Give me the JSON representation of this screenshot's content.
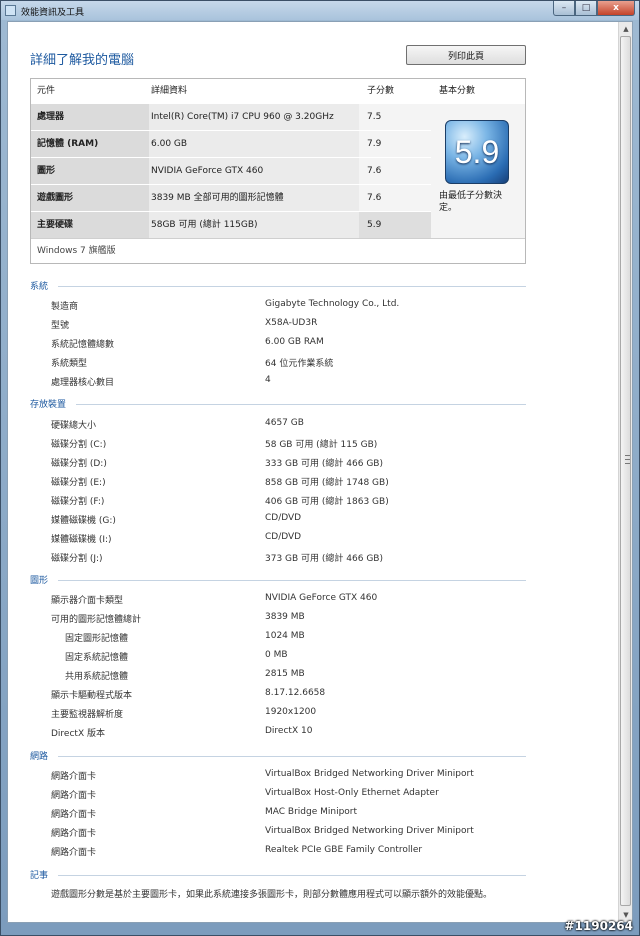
{
  "window": {
    "title": "效能資訊及工具",
    "min_glyph": "–",
    "max_glyph": "□",
    "close_glyph": "x"
  },
  "header": {
    "title": "詳細了解我的電腦",
    "print_label": "列印此頁"
  },
  "summary": {
    "columns": {
      "component": "元件",
      "details": "詳細資料",
      "subscore": "子分數",
      "base": "基本分數"
    },
    "rows": [
      {
        "component": "處理器",
        "details": "Intel(R) Core(TM) i7 CPU 960 @ 3.20GHz",
        "score": "7.5"
      },
      {
        "component": "記憶體 (RAM)",
        "details": "6.00 GB",
        "score": "7.9"
      },
      {
        "component": "圖形",
        "details": "NVIDIA GeForce GTX 460",
        "score": "7.6"
      },
      {
        "component": "遊戲圖形",
        "details": "3839 MB 全部可用的圖形記憶體",
        "score": "7.6"
      },
      {
        "component": "主要硬碟",
        "details": "58GB 可用 (總計 115GB)",
        "score": "5.9"
      }
    ],
    "base_score": "5.9",
    "base_note": "由最低子分數決定。",
    "edition": "Windows 7 旗艦版"
  },
  "sections": [
    {
      "title": "系統",
      "items": [
        {
          "label": "製造商",
          "value": "Gigabyte Technology Co., Ltd."
        },
        {
          "label": "型號",
          "value": "X58A-UD3R"
        },
        {
          "label": "系統記憶體總數",
          "value": "6.00 GB RAM"
        },
        {
          "label": "系統類型",
          "value": "64 位元作業系統"
        },
        {
          "label": "處理器核心數目",
          "value": "4"
        }
      ]
    },
    {
      "title": "存放裝置",
      "items": [
        {
          "label": "硬碟總大小",
          "value": "4657 GB"
        },
        {
          "label": "磁碟分割 (C:)",
          "value": "58 GB 可用 (總計 115 GB)"
        },
        {
          "label": "磁碟分割 (D:)",
          "value": "333 GB 可用 (總計 466 GB)"
        },
        {
          "label": "磁碟分割 (E:)",
          "value": "858 GB 可用 (總計 1748 GB)"
        },
        {
          "label": "磁碟分割 (F:)",
          "value": "406 GB 可用 (總計 1863 GB)"
        },
        {
          "label": "媒體磁碟機 (G:)",
          "value": "CD/DVD"
        },
        {
          "label": "媒體磁碟機 (I:)",
          "value": "CD/DVD"
        },
        {
          "label": "磁碟分割 (J:)",
          "value": "373 GB 可用 (總計 466 GB)"
        }
      ]
    },
    {
      "title": "圖形",
      "items": [
        {
          "label": "顯示器介面卡類型",
          "value": "NVIDIA GeForce GTX 460"
        },
        {
          "label": "可用的圖形記憶體總計",
          "value": "3839 MB"
        },
        {
          "label": "固定圖形記憶體",
          "value": "1024 MB"
        },
        {
          "label": "固定系統記憶體",
          "value": "0 MB"
        },
        {
          "label": "共用系統記憶體",
          "value": "2815 MB"
        },
        {
          "label": "顯示卡驅動程式版本",
          "value": "8.17.12.6658"
        },
        {
          "label": "主要監視器解析度",
          "value": "1920x1200"
        },
        {
          "label": "DirectX 版本",
          "value": "DirectX 10"
        }
      ]
    },
    {
      "title": "網路",
      "items": [
        {
          "label": "網路介面卡",
          "value": "VirtualBox Bridged Networking Driver Miniport"
        },
        {
          "label": "網路介面卡",
          "value": "VirtualBox Host-Only Ethernet Adapter"
        },
        {
          "label": "網路介面卡",
          "value": "MAC Bridge Miniport"
        },
        {
          "label": "網路介面卡",
          "value": "VirtualBox Bridged Networking Driver Miniport"
        },
        {
          "label": "網路介面卡",
          "value": "Realtek PCIe GBE Family Controller"
        }
      ]
    },
    {
      "title": "記事",
      "note": "遊戲圖形分數是基於主要圖形卡，如果此系統連接多張圖形卡，則部分數體應用程式可以顯示額外的效能優點。"
    }
  ],
  "watermark": "#1190264"
}
